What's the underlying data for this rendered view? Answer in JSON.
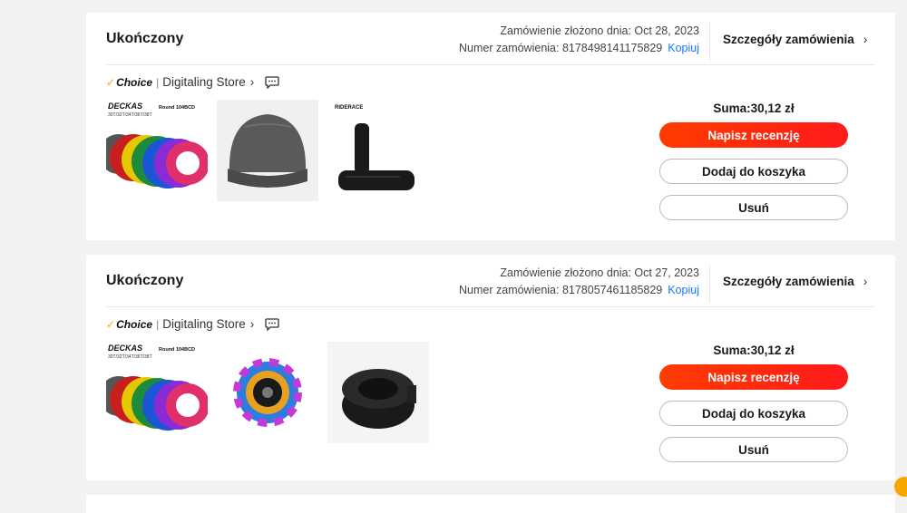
{
  "orders": [
    {
      "status": "Ukończony",
      "placed_label": "Zamówienie złożono dnia: Oct 28, 2023",
      "number_label": "Numer zamówienia: 8178498141175829",
      "copy_label": "Kopiuj",
      "details_label": "Szczegóły zamówienia",
      "choice_label": "Choice",
      "store": "Digitaling Store",
      "total": "Suma:30,12 zł",
      "review_label": "Napisz recenzję",
      "cart_label": "Dodaj do koszyka",
      "delete_label": "Usuń",
      "thumb1_brand": "DECKAS",
      "thumb1_sub": "Round 104BCD",
      "thumb1_sizes": "30T/32T/34T/36T/38T",
      "thumb3_brand": "RIDERACE"
    },
    {
      "status": "Ukończony",
      "placed_label": "Zamówienie złożono dnia: Oct 27, 2023",
      "number_label": "Numer zamówienia: 8178057461185829",
      "copy_label": "Kopiuj",
      "details_label": "Szczegóły zamówienia",
      "choice_label": "Choice",
      "store": "Digitaling Store",
      "total": "Suma:30,12 zł",
      "review_label": "Napisz recenzję",
      "cart_label": "Dodaj do koszyka",
      "delete_label": "Usuń",
      "thumb1_brand": "DECKAS",
      "thumb1_sub": "Round 104BCD",
      "thumb1_sizes": "30T/32T/34T/36T/38T"
    }
  ],
  "colors": {
    "accent": "#ff2d0a",
    "link": "#1677ff",
    "choice_tick": "#f7a800"
  }
}
